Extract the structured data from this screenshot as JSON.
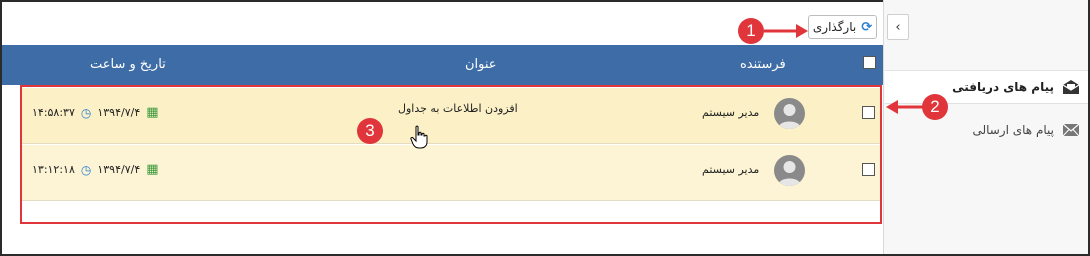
{
  "toolbar": {
    "reload_label": "بارگذاری",
    "reload_icon": "refresh-icon",
    "collapse_icon": "chevron-left-icon"
  },
  "sidebar": {
    "items": [
      {
        "label": "پیام های دریافتی",
        "icon": "envelope-open-icon",
        "active": true
      },
      {
        "label": "پیام های ارسالی",
        "icon": "envelope-icon",
        "active": false
      }
    ]
  },
  "table": {
    "columns": {
      "sender": "فرستنده",
      "title": "عنوان",
      "datetime": "تاریخ و ساعت"
    },
    "rows": [
      {
        "sender": "مدیر سیستم",
        "title": "افزودن اطلاعات به جداول",
        "date": "۱۳۹۴/۷/۴",
        "time": "۱۴:۵۸:۳۷"
      },
      {
        "sender": "مدیر سیستم",
        "title": "",
        "date": "۱۳۹۴/۷/۴",
        "time": "۱۳:۱۲:۱۸"
      }
    ]
  },
  "annotations": {
    "badge_1": "1",
    "badge_2": "2",
    "badge_3": "3",
    "color": "#e0353b"
  },
  "colors": {
    "header": "#3e6ca7",
    "row_highlight": "#fbf0c6",
    "accent": "#2a7fd4"
  }
}
